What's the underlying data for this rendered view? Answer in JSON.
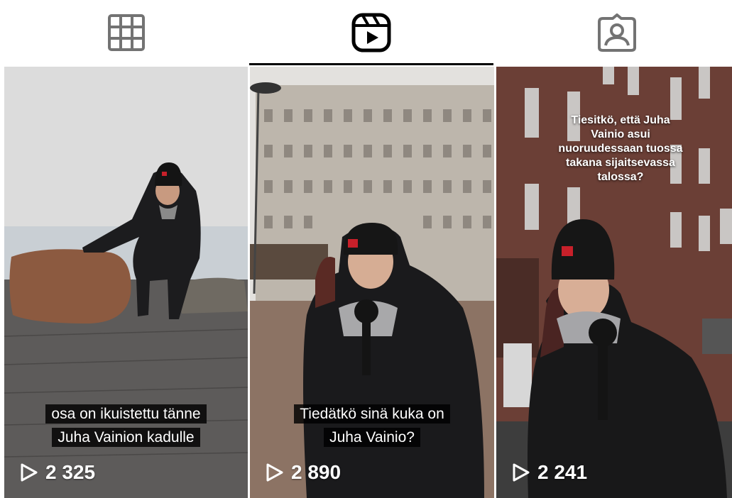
{
  "tabs": [
    {
      "name": "grid",
      "icon": "grid-icon",
      "active": false
    },
    {
      "name": "reels",
      "icon": "reels-icon",
      "active": true
    },
    {
      "name": "tagged",
      "icon": "tagged-icon",
      "active": false
    }
  ],
  "reels": [
    {
      "caption_lines": [
        "osa on ikuistettu tänne",
        "Juha Vainion kadulle"
      ],
      "plays": "2 325"
    },
    {
      "caption_lines": [
        "Tiedätkö sinä kuka on",
        "Juha Vainio?"
      ],
      "plays": "2 890"
    },
    {
      "overlay_text": "Tiesitkö, että Juha Vainio asui nuoruudessaan tuossa takana sijaitsevassa talossa?",
      "plays": "2 241"
    }
  ],
  "colors": {
    "active_icon": "#000000",
    "inactive_icon": "#737373",
    "indicator": "#000000"
  }
}
